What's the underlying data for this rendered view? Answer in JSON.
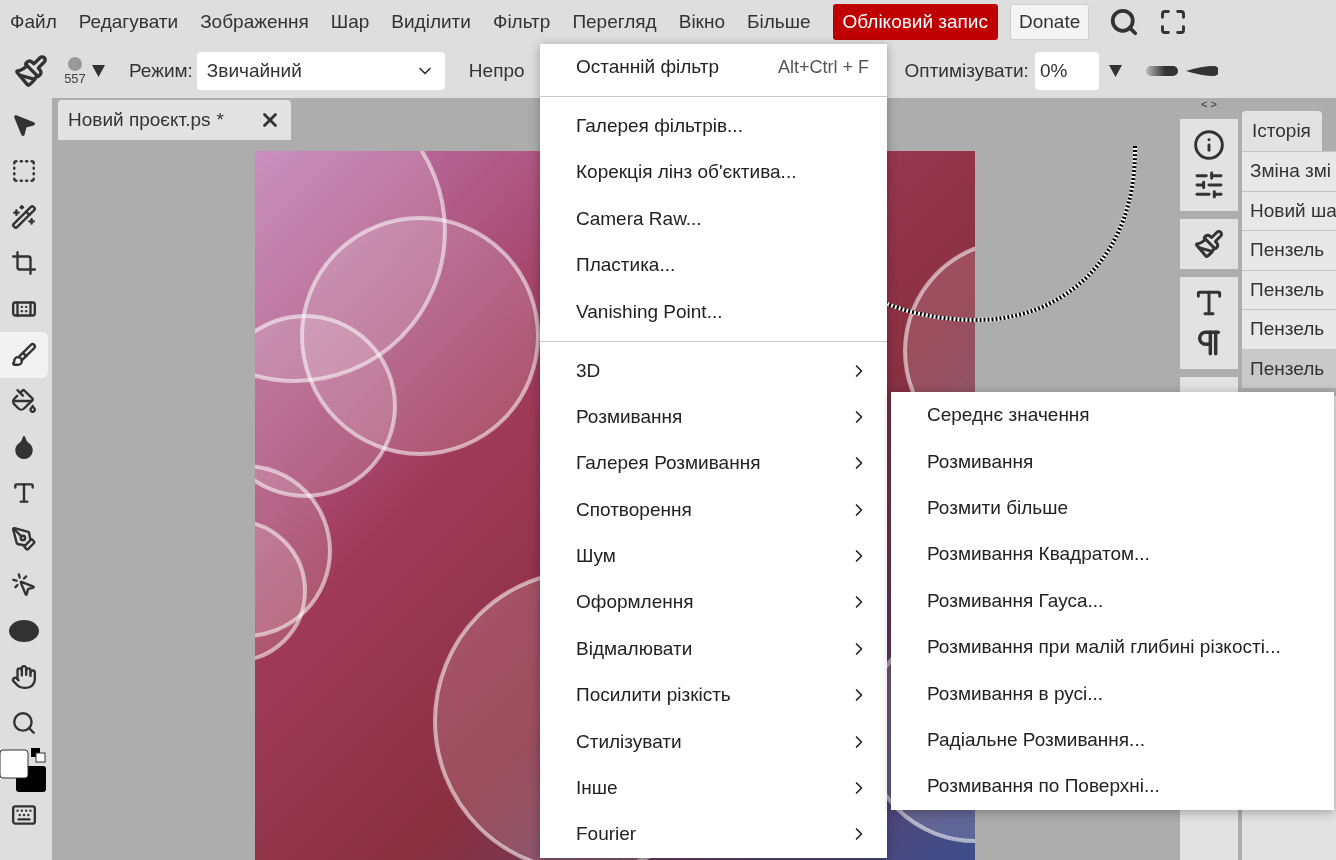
{
  "menubar": {
    "items": [
      "Файл",
      "Редагувати",
      "Зображення",
      "Шар",
      "Виділити",
      "Фільтр",
      "Перегляд",
      "Вікно",
      "Більше"
    ],
    "account_button": "Обліковий запис",
    "donate_button": "Donate"
  },
  "options_bar": {
    "brush_size": "557",
    "mode_label": "Режим:",
    "mode_value": "Звичайний",
    "opacity_label": "Непро",
    "optimize_label": "Оптимізувати:",
    "optimize_value": "0%"
  },
  "tools": [
    {
      "kind": "move",
      "selected": false
    },
    {
      "kind": "marquee",
      "selected": false
    },
    {
      "kind": "wand",
      "selected": false
    },
    {
      "kind": "crop",
      "selected": false
    },
    {
      "kind": "heal",
      "selected": false
    },
    {
      "kind": "brush",
      "selected": true
    },
    {
      "kind": "bucket",
      "selected": false
    },
    {
      "kind": "blur",
      "selected": false
    },
    {
      "kind": "type",
      "selected": false
    },
    {
      "kind": "pen",
      "selected": false
    },
    {
      "kind": "path",
      "selected": false
    },
    {
      "kind": "ellipse",
      "selected": false
    },
    {
      "kind": "hand",
      "selected": false
    },
    {
      "kind": "zoom",
      "selected": false
    },
    {
      "kind": "colors",
      "selected": false
    },
    {
      "kind": "keyboard",
      "selected": false
    }
  ],
  "document_tab": {
    "title": "Новий проєкт.ps",
    "modified_mark": "*"
  },
  "panel_toggle": "< >",
  "history": {
    "tab": "Історія",
    "items": [
      {
        "label": "Зміна змі",
        "selected": false
      },
      {
        "label": "Новий ша",
        "selected": false
      },
      {
        "label": "Пензель",
        "selected": false
      },
      {
        "label": "Пензель",
        "selected": false
      },
      {
        "label": "Пензель",
        "selected": false
      },
      {
        "label": "Пензель",
        "selected": true
      }
    ]
  },
  "filter_menu": {
    "items": [
      {
        "kind": "item",
        "label": "Останній фільтр",
        "shortcut": "Alt+Ctrl + F"
      },
      {
        "kind": "separator"
      },
      {
        "kind": "item",
        "label": "Галерея фільтрів..."
      },
      {
        "kind": "item",
        "label": "Корекція лінз об'єктива..."
      },
      {
        "kind": "item",
        "label": "Camera Raw..."
      },
      {
        "kind": "item",
        "label": "Пластика..."
      },
      {
        "kind": "item",
        "label": "Vanishing Point..."
      },
      {
        "kind": "separator"
      },
      {
        "kind": "submenu",
        "label": "3D"
      },
      {
        "kind": "submenu",
        "label": "Розмивання"
      },
      {
        "kind": "submenu",
        "label": "Галерея Розмивання"
      },
      {
        "kind": "submenu",
        "label": "Спотворення"
      },
      {
        "kind": "submenu",
        "label": "Шум"
      },
      {
        "kind": "submenu",
        "label": "Оформлення"
      },
      {
        "kind": "submenu",
        "label": "Відмалювати"
      },
      {
        "kind": "submenu",
        "label": "Посилити різкість"
      },
      {
        "kind": "submenu",
        "label": "Стилізувати"
      },
      {
        "kind": "submenu",
        "label": "Інше"
      },
      {
        "kind": "submenu",
        "label": "Fourier"
      }
    ]
  },
  "blur_submenu": {
    "items": [
      "Середнє значення",
      "Розмивання",
      "Розмити більше",
      "Розмивання Квадратом...",
      "Розмивання Гауса...",
      "Розмивання при малій глибині різкості...",
      "Розмивання в русі...",
      "Радіальне Розмивання...",
      "Розмивання по Поверхні..."
    ]
  }
}
